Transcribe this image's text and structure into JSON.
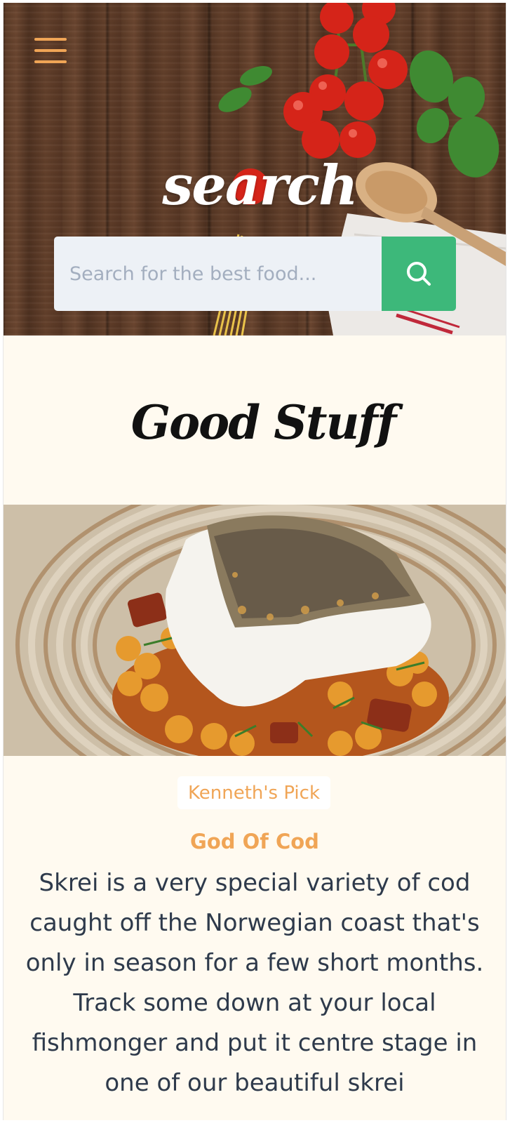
{
  "header": {
    "menu_icon": "hamburger-icon",
    "title": "search",
    "search": {
      "placeholder": "Search for the best food...",
      "value": "",
      "button_icon": "search-icon"
    }
  },
  "section": {
    "title": "Good Stuff"
  },
  "featured": {
    "badge": "Kenneth's Pick",
    "dish_name": "God Of Cod",
    "description": "Skrei is a very special variety of cod caught off the Norwegian coast that's only in season for a few short months. Track some down at your local fishmonger and put it centre stage in one of our beautiful skrei"
  },
  "colors": {
    "accent": "#f0a556",
    "search_button": "#3db87a",
    "page_background": "#fffaf0",
    "body_text": "#2e3a4b"
  }
}
